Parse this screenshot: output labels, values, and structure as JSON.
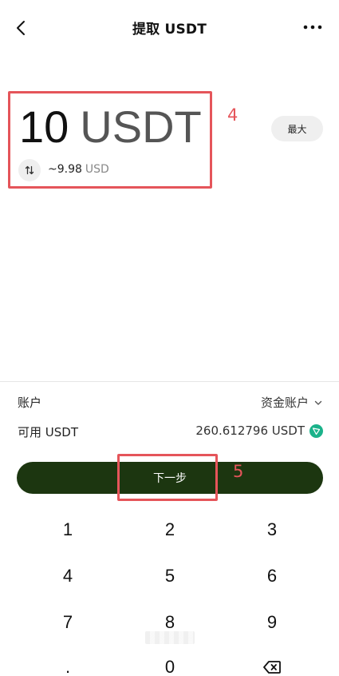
{
  "header": {
    "title": "提取 USDT"
  },
  "amount": {
    "value": "10",
    "unit": "USDT",
    "fiat_value": "~9.98",
    "fiat_unit": "USD",
    "max_label": "最大"
  },
  "annotations": {
    "step4": "4",
    "step5": "5",
    "color": "#e5555a"
  },
  "account": {
    "label": "账户",
    "value": "资金账户"
  },
  "available": {
    "label": "可用 USDT",
    "value": "260.612796 USDT"
  },
  "next_button": {
    "label": "下一步",
    "color": "#1c3610"
  },
  "keypad": {
    "keys": [
      "1",
      "2",
      "3",
      "4",
      "5",
      "6",
      "7",
      "8",
      "9",
      ".",
      "0"
    ],
    "backspace_icon": "backspace-icon"
  }
}
